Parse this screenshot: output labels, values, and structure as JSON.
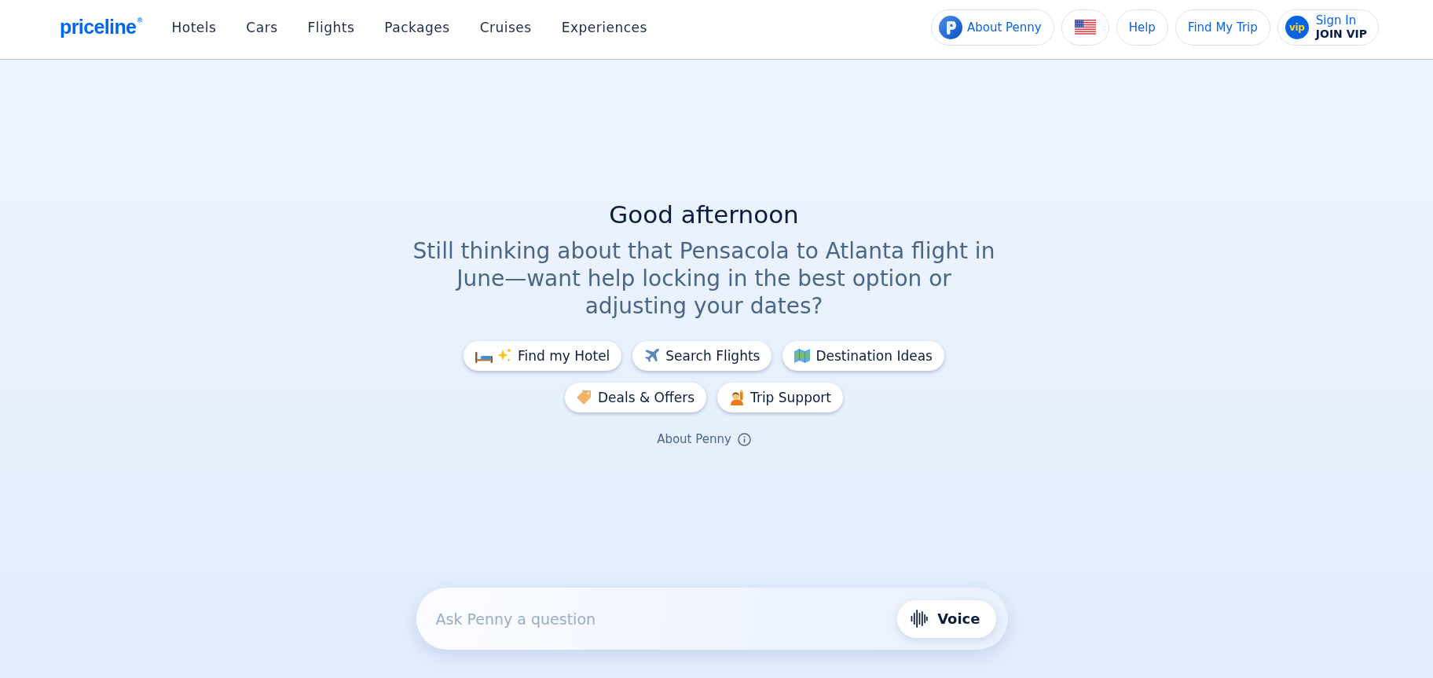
{
  "header": {
    "logo": "priceline",
    "logo_mark": "®",
    "nav": [
      {
        "label": "Hotels"
      },
      {
        "label": "Cars"
      },
      {
        "label": "Flights"
      },
      {
        "label": "Packages"
      },
      {
        "label": "Cruises"
      },
      {
        "label": "Experiences"
      }
    ],
    "actions": [
      {
        "kind": "penny",
        "label": "About Penny"
      },
      {
        "kind": "flag"
      },
      {
        "kind": "text",
        "label": "Help"
      },
      {
        "kind": "text",
        "label": "Find My Trip"
      },
      {
        "kind": "account",
        "badge": "vip",
        "label": "Sign In",
        "sublabel": "JOIN VIP"
      }
    ]
  },
  "greeting": {
    "title": "Good afternoon",
    "message": "Still thinking about that Pensacola to Atlanta flight in June—want help locking in the best option or adjusting your dates?"
  },
  "suggestions": [
    {
      "label": "Find my Hotel"
    },
    {
      "label": "Search Flights"
    },
    {
      "label": "Destination Ideas"
    },
    {
      "label": "Deals & Offers"
    },
    {
      "label": "Trip Support"
    }
  ],
  "about_link": {
    "label": "About Penny"
  },
  "composer": {
    "placeholder": "Ask Penny a question",
    "voice_button": "Voice"
  }
}
